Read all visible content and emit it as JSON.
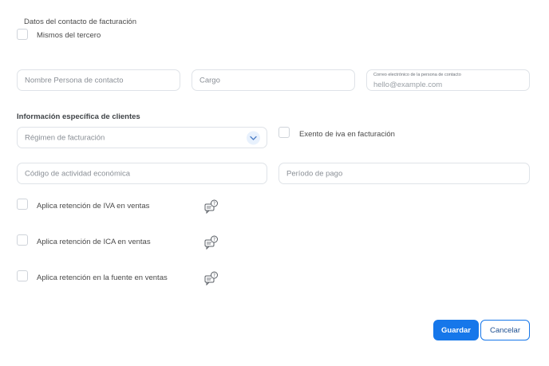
{
  "billing_contact": {
    "heading": "Datos del contacto de facturación",
    "same_as_third_party_label": "Mismos del tercero",
    "contact_name_placeholder": "Nombre Persona de contacto",
    "position_placeholder": "Cargo",
    "email_label": "Correo electrónico de la persona de contacto",
    "email_placeholder": "hello@example.com"
  },
  "client_info": {
    "heading": "Información específica de clientes",
    "billing_regime_placeholder": "Régimen de facturación",
    "vat_exempt_label": "Exento de iva en facturación",
    "economic_activity_placeholder": "Código de actividad económica",
    "payment_period_placeholder": "Período de pago",
    "withholdings": [
      {
        "label": "Aplica retención de IVA en ventas",
        "help_icon": "help-chat-icon"
      },
      {
        "label": "Aplica retención de ICA en ventas",
        "help_icon": "help-chat-icon"
      },
      {
        "label": "Aplica retención en la fuente en ventas",
        "help_icon": "help-chat-icon"
      }
    ]
  },
  "actions": {
    "save_label": "Guardar",
    "cancel_label": "Cancelar"
  },
  "colors": {
    "primary": "#1677ea",
    "border": "#dfe3e8",
    "chevron_bg": "#e8f1fd"
  }
}
